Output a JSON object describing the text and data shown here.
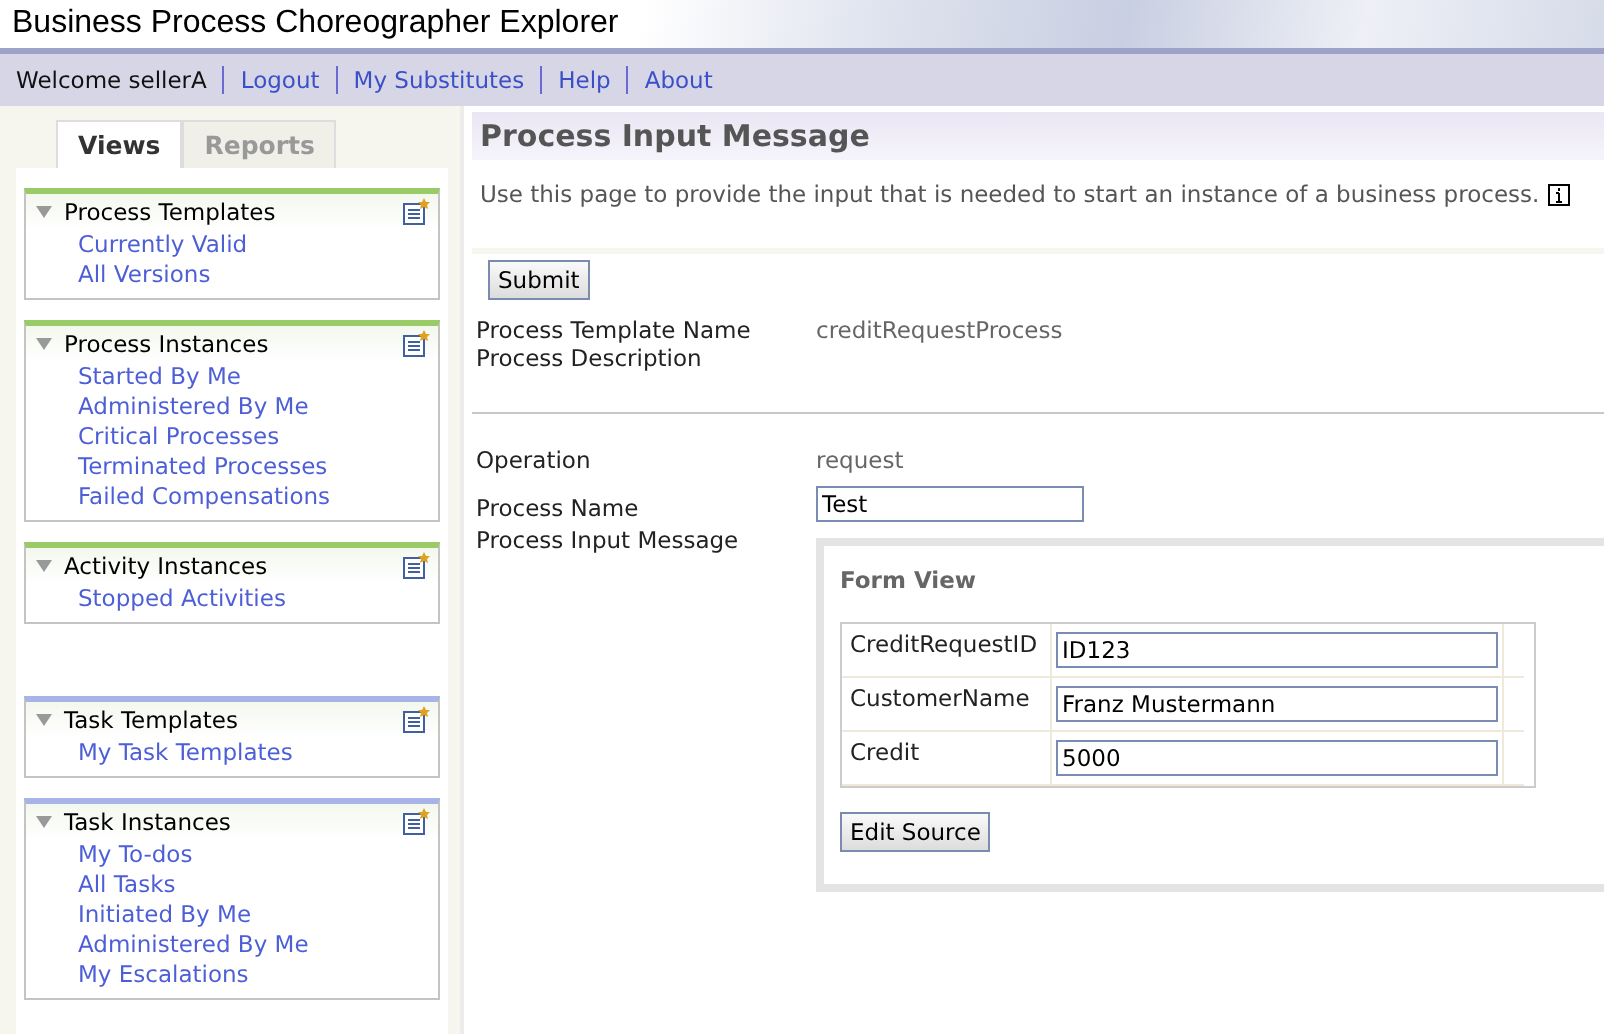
{
  "window": {
    "title": "Business Process Choreographer Explorer"
  },
  "nav": {
    "welcome": "Welcome sellerA",
    "links": [
      "Logout",
      "My Substitutes",
      "Help",
      "About"
    ]
  },
  "tabs": [
    {
      "label": "Views",
      "selected": true
    },
    {
      "label": "Reports",
      "selected": false
    }
  ],
  "sidebar": {
    "groups": [
      [
        {
          "title": "Process Templates",
          "color": "#99cc66",
          "expanded": true,
          "items": [
            "Currently Valid",
            "All Versions"
          ]
        },
        {
          "title": "Process Instances",
          "color": "#99cc66",
          "expanded": true,
          "items": [
            "Started By Me",
            "Administered By Me",
            "Critical Processes",
            "Terminated Processes",
            "Failed Compensations"
          ]
        },
        {
          "title": "Activity Instances",
          "color": "#99cc66",
          "expanded": true,
          "items": [
            "Stopped Activities"
          ]
        }
      ],
      [
        {
          "title": "Task Templates",
          "color": "#a8b4e8",
          "expanded": true,
          "items": [
            "My Task Templates"
          ]
        },
        {
          "title": "Task Instances",
          "color": "#a8b4e8",
          "expanded": true,
          "items": [
            "My To-dos",
            "All Tasks",
            "Initiated By Me",
            "Administered By Me",
            "My Escalations"
          ]
        }
      ]
    ]
  },
  "main": {
    "heading": "Process Input Message",
    "description": "Use this page to provide the input that is needed to start an instance of a business process.",
    "submit": "Submit",
    "details": [
      {
        "label": "Process Template Name",
        "value": "creditRequestProcess"
      },
      {
        "label": "Process Description"
      }
    ],
    "operation": {
      "label": "Operation",
      "value": "request"
    },
    "process_name": {
      "label": "Process Name",
      "value": "Test"
    },
    "input_message": {
      "label": "Process Input Message",
      "form_title": "Form View",
      "fields": [
        {
          "label": "CreditRequestID",
          "value": "ID123"
        },
        {
          "label": "CustomerName",
          "value": "Franz Mustermann"
        },
        {
          "label": "Credit",
          "value": "5000"
        }
      ],
      "edit_button": "Edit Source"
    }
  }
}
